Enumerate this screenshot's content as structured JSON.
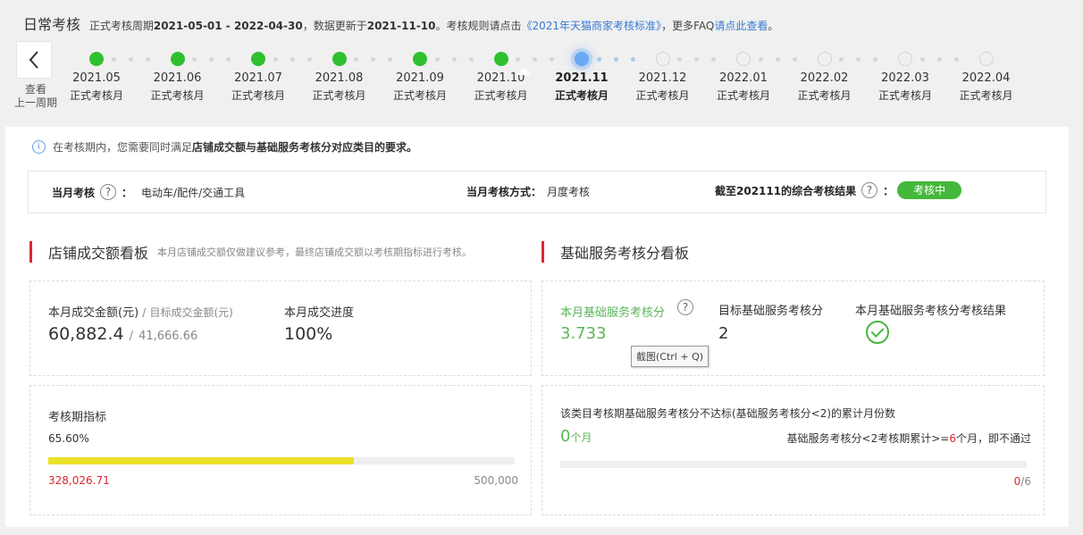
{
  "header": {
    "title": "日常考核",
    "period_label": "正式考核周期",
    "period_range": "2021-05-01 - 2022-04-30",
    "update_label": "，数据更新于",
    "update_date": "2021-11-10",
    "rule_text": "。考核规则请点击",
    "rule_link": "《2021年天猫商家考核标准》",
    "faq_prefix": "，更多FAQ",
    "faq_link": "请点此查看",
    "faq_suffix": "。"
  },
  "nav": {
    "prev_label_1": "查看",
    "prev_label_2": "上一周期"
  },
  "timeline": [
    {
      "month": "2021.05",
      "sub": "正式考核月",
      "state": "done"
    },
    {
      "month": "2021.06",
      "sub": "正式考核月",
      "state": "done"
    },
    {
      "month": "2021.07",
      "sub": "正式考核月",
      "state": "done"
    },
    {
      "month": "2021.08",
      "sub": "正式考核月",
      "state": "done"
    },
    {
      "month": "2021.09",
      "sub": "正式考核月",
      "state": "done"
    },
    {
      "month": "2021.10",
      "sub": "正式考核月",
      "state": "done"
    },
    {
      "month": "2021.11",
      "sub": "正式考核月",
      "state": "current"
    },
    {
      "month": "2021.12",
      "sub": "正式考核月",
      "state": "future"
    },
    {
      "month": "2022.01",
      "sub": "正式考核月",
      "state": "future"
    },
    {
      "month": "2022.02",
      "sub": "正式考核月",
      "state": "future"
    },
    {
      "month": "2022.03",
      "sub": "正式考核月",
      "state": "future"
    },
    {
      "month": "2022.04",
      "sub": "正式考核月",
      "state": "future"
    }
  ],
  "notice": {
    "pre": "在考核期内，您需要同时满足",
    "bold": "店铺成交额与基础服务考核分对应类目的要求。"
  },
  "summary": {
    "month_label": "当月考核",
    "colon": "：",
    "category": "电动车/配件/交通工具",
    "method_label": "当月考核方式：",
    "method_value": "月度考核",
    "result_label": "截至202111的综合考核结果",
    "result_status": "考核中"
  },
  "gmv_board": {
    "title": "店铺成交额看板",
    "note": "本月店铺成交额仅做建议参考，最终店铺成交额以考核期指标进行考核。",
    "amount_label": "本月成交金额(元)",
    "slash": "/",
    "target_label": "目标成交金额(元)",
    "amount_value": "60,882.4",
    "target_value": "41,666.66",
    "progress_label": "本月成交进度",
    "progress_value": "100%",
    "period_label": "考核期指标",
    "period_percent": "65.60%",
    "period_fraction": 0.656,
    "period_current": "328,026.71",
    "period_target": "500,000"
  },
  "service_board": {
    "title": "基础服务考核分看板",
    "score_label": "本月基础服务考核分",
    "score_value": "3.733",
    "target_label": "目标基础服务考核分",
    "target_value": "2",
    "result_label": "本月基础服务考核分考核结果",
    "tooltip": "截图(Ctrl + Q)",
    "fail_label": "该类目考核期基础服务考核分不达标(基础服务考核分<2)的累计月份数",
    "fail_count": "0",
    "fail_unit": "个月",
    "rule_pre": "基础服务考核分<2考核期累计>=",
    "rule_num": "6",
    "rule_post": "个月，即不通过",
    "fail_fraction": 0,
    "fail_current": "0",
    "fail_total": "/6"
  },
  "colors": {
    "accent_red": "#e0242f",
    "done_green": "#2ec02e",
    "current_blue": "#6aa9f2",
    "progress_yellow": "#ebe12a",
    "link_blue": "#3a7bd5"
  }
}
